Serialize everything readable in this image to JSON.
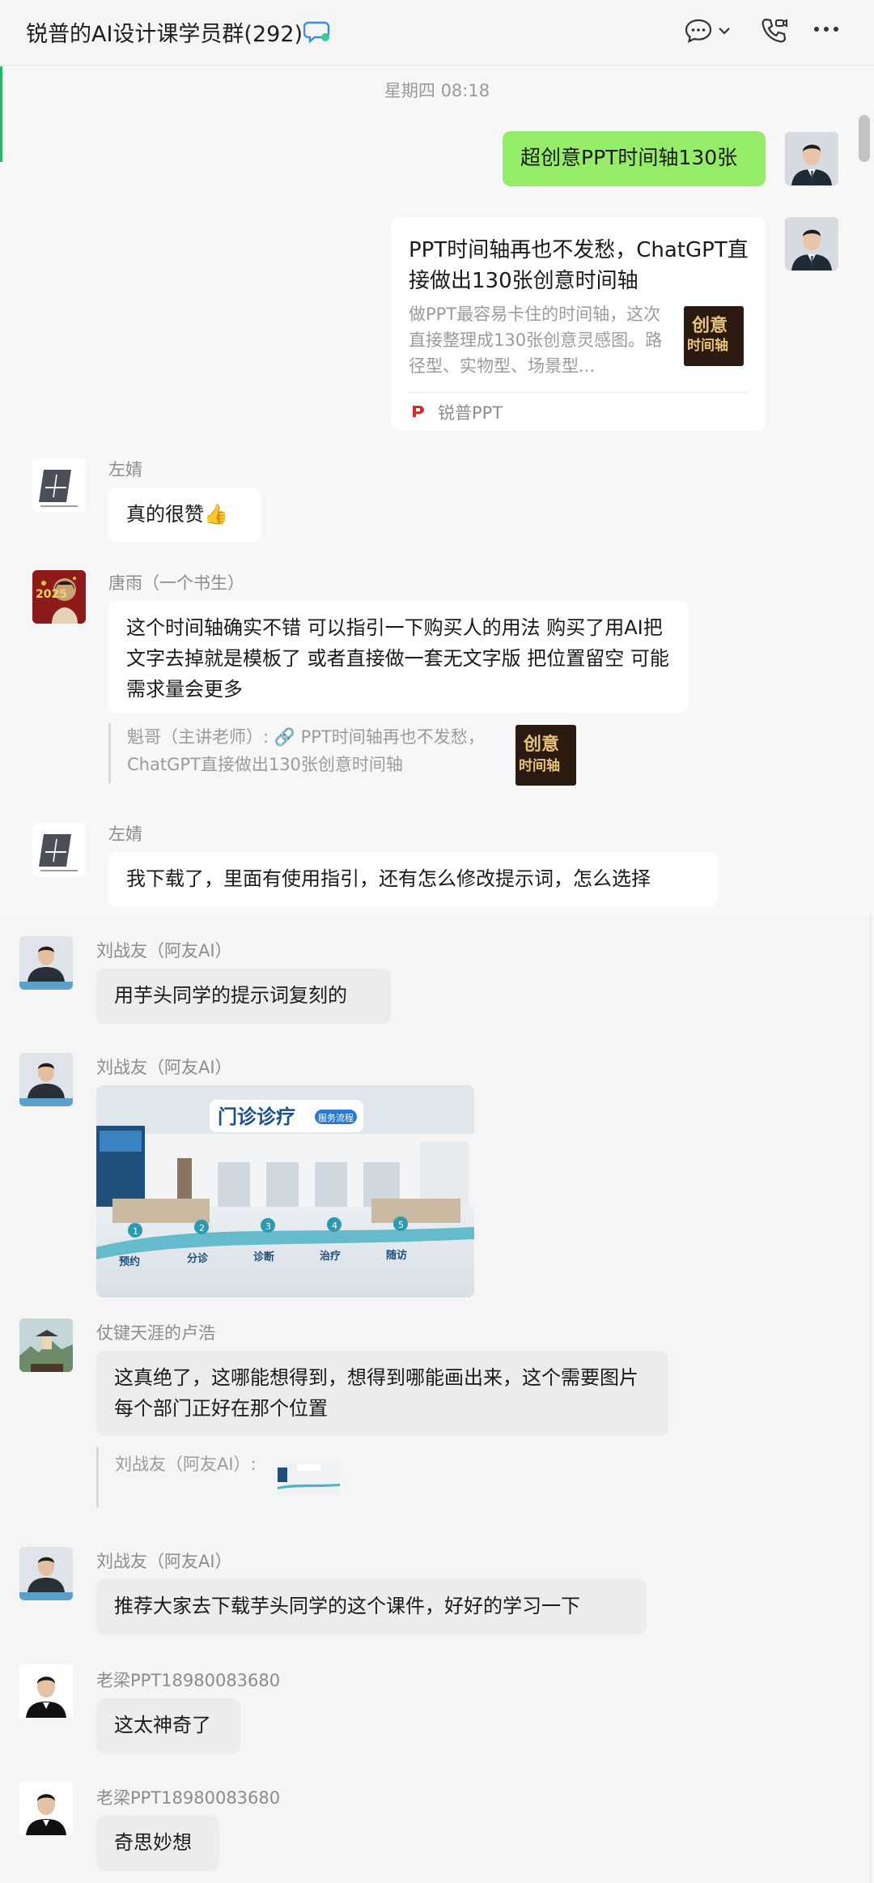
{
  "header": {
    "title": "锐普的AI设计课学员群(292)",
    "icons": [
      "ai-chat-icon",
      "chat-bubble-icon",
      "chevron-down-icon",
      "phone-video-icon",
      "more-icon"
    ]
  },
  "chat": {
    "timestamp": "星期四 08:18",
    "m1": {
      "text": "超创意PPT时间轴130张"
    },
    "card": {
      "title": "PPT时间轴再也不发愁，ChatGPT直接做出130张创意时间轴",
      "desc": "做PPT最容易卡住的时间轴，这次直接整理成130张创意灵感图。路径型、实物型、场景型...",
      "source": "锐普PPT",
      "thumb_text_1": "创意",
      "thumb_text_2": "时间轴"
    },
    "m3": {
      "sender": "左婧",
      "text": "真的很赞👍"
    },
    "m4": {
      "sender": "唐雨（一个书生）",
      "text": "这个时间轴确实不错  可以指引一下购买人的用法 购买了用AI把文字去掉就是模板了 或者直接做一套无文字版 把位置留空 可能需求量会更多",
      "quote": "魁哥（主讲老师）: 🔗 PPT时间轴再也不发愁，ChatGPT直接做出130张创意时间轴",
      "avatar_text": "2025"
    },
    "m5": {
      "sender": "左婧",
      "text": "我下载了，里面有使用指引，还有怎么修改提示词，怎么选择"
    },
    "m6": {
      "sender": "刘战友（阿友AI）",
      "text": "用芋头同学的提示词复刻的"
    },
    "m7": {
      "sender": "刘战友（阿友AI）",
      "image": {
        "heading": "门诊诊疗",
        "badge": "服务流程",
        "steps": [
          "预约",
          "分诊",
          "诊断",
          "治疗",
          "随访"
        ],
        "step_numbers": [
          "1",
          "2",
          "3",
          "4",
          "5"
        ]
      }
    },
    "m8": {
      "sender": "仗键天涯的卢浩",
      "text": "这真绝了，这哪能想得到，想得到哪能画出来，这个需要图片每个部门正好在那个位置",
      "quote": "刘战友（阿友AI）:"
    },
    "m9": {
      "sender": "刘战友（阿友AI）",
      "text": "推荐大家去下载芋头同学的这个课件，好好的学习一下"
    },
    "m10": {
      "sender": "老梁PPT18980083680",
      "text": "这太神奇了"
    },
    "m11": {
      "sender": "老梁PPT18980083680",
      "text": "奇思妙想"
    }
  },
  "colors": {
    "self_bubble": "#95ec69",
    "accent": "#2fb36b",
    "background": "#f5f5f5"
  }
}
